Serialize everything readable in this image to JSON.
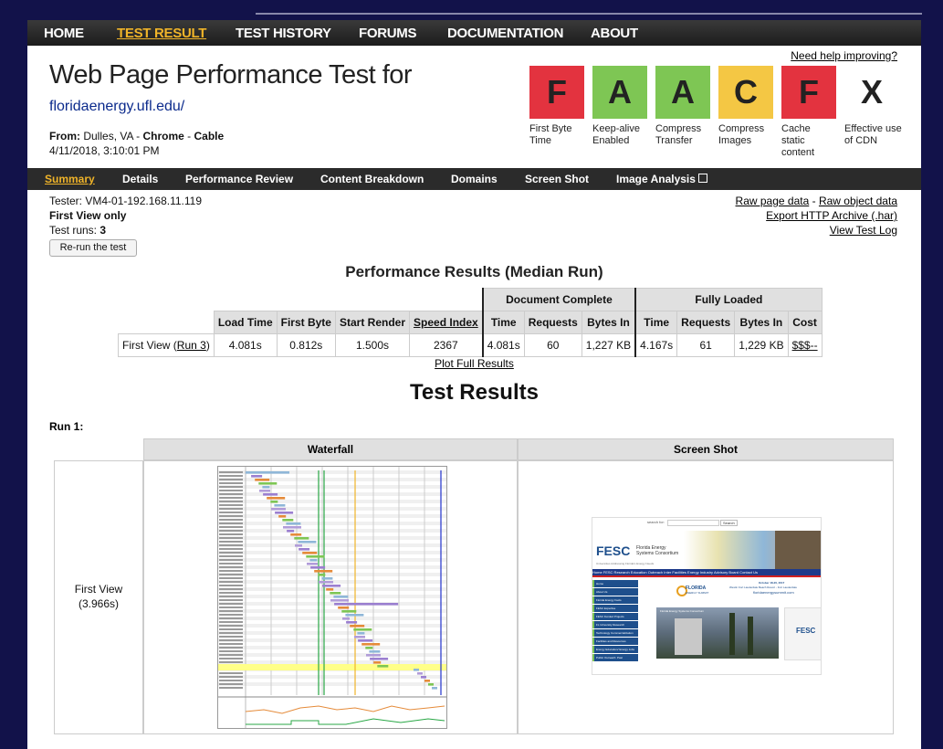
{
  "nav": {
    "items": [
      "HOME",
      "TEST RESULT",
      "TEST HISTORY",
      "FORUMS",
      "DOCUMENTATION",
      "ABOUT"
    ],
    "active": "TEST RESULT"
  },
  "header": {
    "help_link": "Need help improving?",
    "title": "Web Page Performance Test for",
    "url": "floridaenergy.ufl.edu/",
    "from_label": "From:",
    "from_value": "Dulles, VA - ",
    "browser": "Chrome",
    "sep": " - ",
    "connection": "Cable",
    "date": "4/11/2018, 3:10:01 PM"
  },
  "grades": [
    {
      "letter": "F",
      "label": "First Byte Time",
      "color": "#e3333f"
    },
    {
      "letter": "A",
      "label": "Keep-alive Enabled",
      "color": "#7ec654"
    },
    {
      "letter": "A",
      "label": "Compress Transfer",
      "color": "#7ec654"
    },
    {
      "letter": "C",
      "label": "Compress Images",
      "color": "#f4c744"
    },
    {
      "letter": "F",
      "label": "Cache static content",
      "color": "#e3333f"
    },
    {
      "letter": "X",
      "label": "Effective use of CDN",
      "color": "#ffffff"
    }
  ],
  "subnav": {
    "items": [
      "Summary",
      "Details",
      "Performance Review",
      "Content Breakdown",
      "Domains",
      "Screen Shot",
      "Image Analysis"
    ],
    "active": "Summary"
  },
  "info": {
    "tester": "Tester: VM4-01-192.168.11.119",
    "view": "First View only",
    "runs_label": "Test runs: ",
    "runs_value": "3",
    "rerun": "Re-run the test",
    "raw_page": "Raw page data",
    "dash": " - ",
    "raw_object": "Raw object data",
    "export": "Export HTTP Archive (.har)",
    "log": "View Test Log"
  },
  "perf": {
    "title": "Performance Results (Median Run)",
    "group_doc": "Document Complete",
    "group_full": "Fully Loaded",
    "headers": [
      "Load Time",
      "First Byte",
      "Start Render",
      "Speed Index",
      "Time",
      "Requests",
      "Bytes In",
      "Time",
      "Requests",
      "Bytes In",
      "Cost"
    ],
    "row_label": "First View (",
    "row_link": "Run 3",
    "row_close": ")",
    "values": [
      "4.081s",
      "0.812s",
      "1.500s",
      "2367",
      "4.081s",
      "60",
      "1,227 KB",
      "4.167s",
      "61",
      "1,229 KB",
      "$$$--"
    ],
    "plot_link": "Plot Full Results"
  },
  "results": {
    "title": "Test Results",
    "run": "Run 1:",
    "col_waterfall": "Waterfall",
    "col_screenshot": "Screen Shot",
    "row_label": "First View",
    "row_time": "(3.966s)"
  },
  "screenshot": {
    "search_label": "search for:",
    "search_btn": "Search",
    "org_short": "FESC",
    "org_line1": "Florida Energy",
    "org_line2": "Systems Consortium",
    "tagline": "Universities Addressing Florida's Energy Needs",
    "menu": "Home FESC Research Education Outreach Inter Facilities Energy Industry Advisory Board Contact Us",
    "side_items": [
      "Home",
      "About Us",
      "Florida Energy Facts",
      "FESC Expertise",
      "FESC Funded Projects",
      "FL University Research",
      "Technology Commercialization",
      "Facilities and Resources",
      "Energy Education/ Energy Jobs",
      "Public Outreach: Past"
    ],
    "event_date": "October 18-20, 2017",
    "event_venue": "Westin Fort Lauderdale Beach Resort - Fort Lauderdale",
    "event_url": "floridaenergysummit.com",
    "event_brand": "FLORIDA",
    "event_brand2": "ENERGY SUMMIT",
    "caption": "Florida Energy Systems Consortium"
  },
  "colors": {
    "accent": "#f0b429",
    "link": "#0b2a8c"
  }
}
